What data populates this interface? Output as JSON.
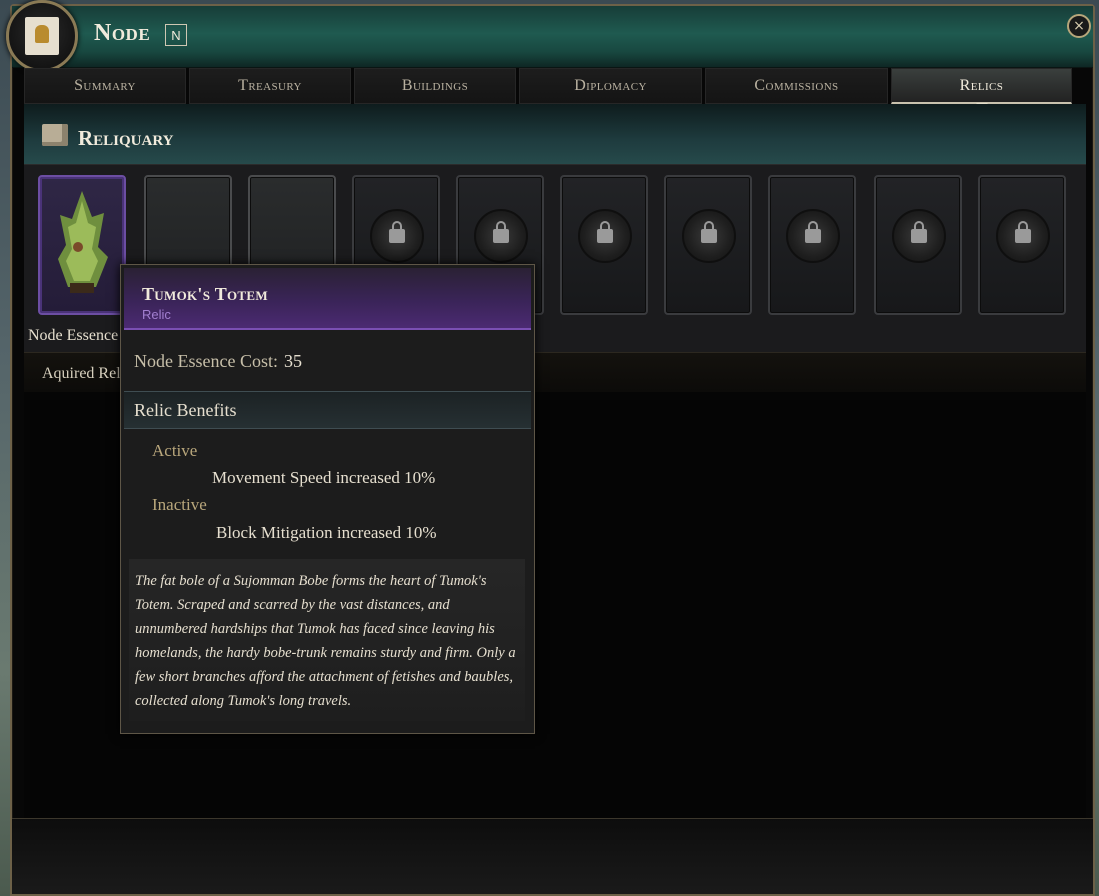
{
  "window": {
    "title": "Node",
    "hotkey": "N",
    "close_glyph": "×"
  },
  "tabs": [
    {
      "label": "Summary",
      "active": false
    },
    {
      "label": "Treasury",
      "active": false
    },
    {
      "label": "Buildings",
      "active": false
    },
    {
      "label": "Diplomacy",
      "active": false
    },
    {
      "label": "Commissions",
      "active": false
    },
    {
      "label": "Relics",
      "active": true
    }
  ],
  "reliquary": {
    "title": "Reliquary",
    "icon": "crate-icon",
    "slot_caption": "Node Essence",
    "acquired_label": "Aquired Relics",
    "slots": [
      {
        "state": "filled"
      },
      {
        "state": "empty"
      },
      {
        "state": "empty"
      },
      {
        "state": "locked"
      },
      {
        "state": "locked"
      },
      {
        "state": "locked"
      },
      {
        "state": "locked"
      },
      {
        "state": "locked"
      },
      {
        "state": "locked"
      },
      {
        "state": "locked"
      }
    ]
  },
  "tooltip": {
    "name": "Tumok's Totem",
    "type": "Relic",
    "cost_label": "Node Essence Cost:",
    "cost_value": "35",
    "benefits_title": "Relic Benefits",
    "active_label": "Active",
    "active_effect": "Movement Speed increased 10%",
    "inactive_label": "Inactive",
    "inactive_effect": "Block Mitigation increased 10%",
    "lore": "The fat bole of a Sujomman Bobe forms the heart of Tumok's Totem. Scraped and scarred by the vast distances, and unnumbered hardships that Tumok has faced since leaving his homelands, the hardy bobe-trunk remains sturdy and firm. Only a few short branches afford the attachment of fetishes and baubles, collected along Tumok's long travels."
  },
  "colors": {
    "accent_purple": "#4b2a72",
    "title_teal": "#1f5a50",
    "gold_border": "#6d6148"
  }
}
